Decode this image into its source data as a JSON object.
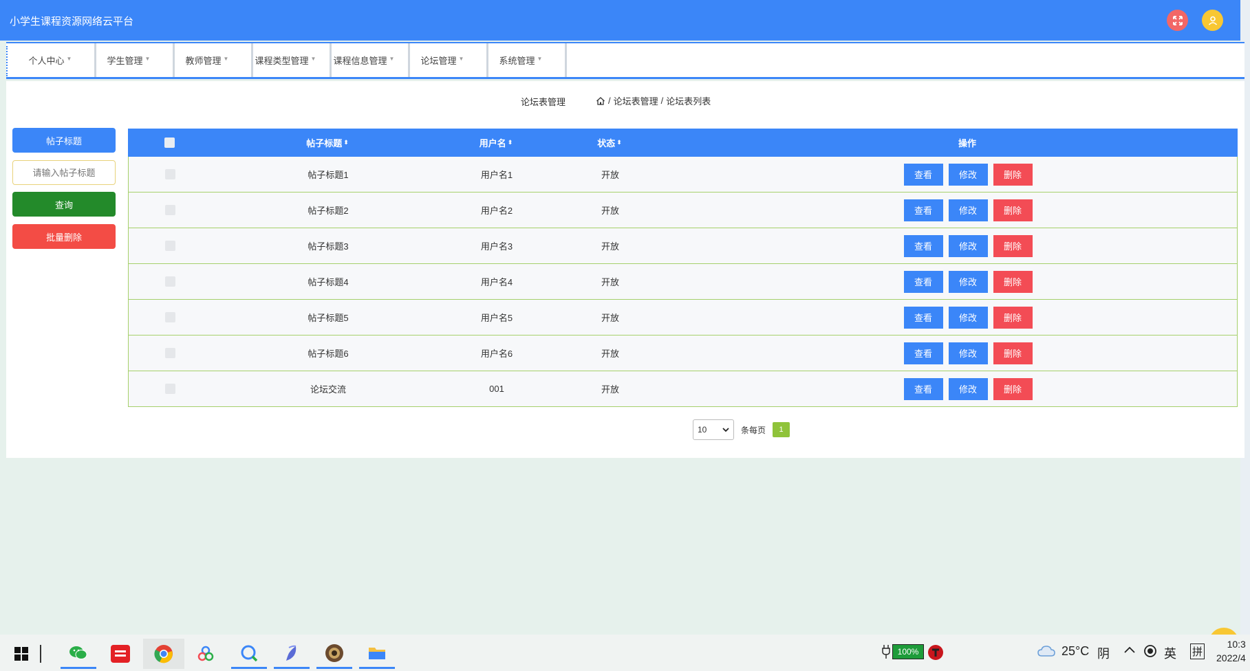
{
  "app": {
    "title": "小学生课程资源网络云平台"
  },
  "nav": {
    "items": [
      {
        "label": "个人中心"
      },
      {
        "label": "学生管理"
      },
      {
        "label": "教师管理"
      },
      {
        "label": "课程类型管理"
      },
      {
        "label": "课程信息管理"
      },
      {
        "label": "论坛管理"
      },
      {
        "label": "系统管理"
      }
    ]
  },
  "breadcrumb": {
    "page_title": "论坛表管理",
    "path": [
      "论坛表管理",
      "论坛表列表"
    ],
    "separator": "/"
  },
  "search": {
    "label": "帖子标题",
    "placeholder": "请输入帖子标题",
    "query_button": "查询",
    "batch_delete_button": "批量删除"
  },
  "table": {
    "headers": {
      "title": "帖子标题",
      "user": "用户名",
      "status": "状态",
      "ops": "操作"
    },
    "sort_icon": "⬍",
    "rows": [
      {
        "title": "帖子标题1",
        "user": "用户名1",
        "status": "开放"
      },
      {
        "title": "帖子标题2",
        "user": "用户名2",
        "status": "开放"
      },
      {
        "title": "帖子标题3",
        "user": "用户名3",
        "status": "开放"
      },
      {
        "title": "帖子标题4",
        "user": "用户名4",
        "status": "开放"
      },
      {
        "title": "帖子标题5",
        "user": "用户名5",
        "status": "开放"
      },
      {
        "title": "帖子标题6",
        "user": "用户名6",
        "status": "开放"
      },
      {
        "title": "论坛交流",
        "user": "001",
        "status": "开放"
      }
    ],
    "actions": {
      "view": "查看",
      "edit": "修改",
      "delete": "删除"
    }
  },
  "pagination": {
    "page_size": "10",
    "per_page_label": "条每页",
    "current_page": "1"
  },
  "taskbar": {
    "battery": "100%",
    "weather_temp": "25°C",
    "weather_desc": "阴",
    "ime_lang": "英",
    "ime_mode": "拼",
    "time": "10:3",
    "date": "2022/4"
  },
  "colors": {
    "primary": "#3b86f8",
    "success": "#238a2a",
    "danger": "#f34c55",
    "row_border": "#a5d06a",
    "page_active": "#8fc33a"
  }
}
